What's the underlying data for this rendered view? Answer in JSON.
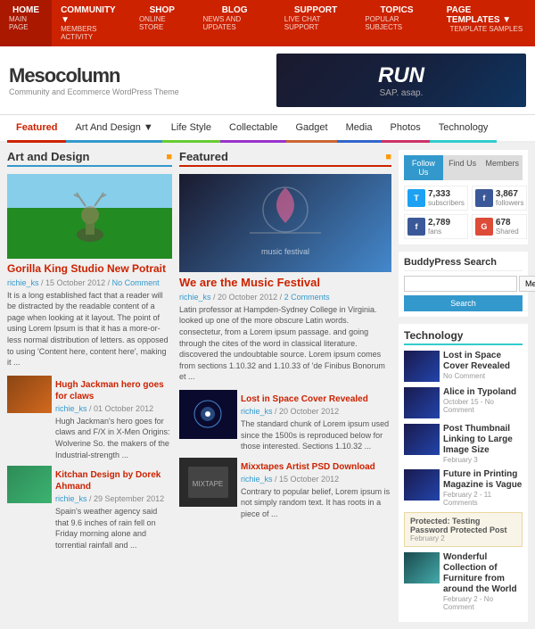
{
  "topnav": {
    "items": [
      {
        "label": "HOME",
        "sub": "main page",
        "hasArrow": false
      },
      {
        "label": "COMMUNITY",
        "sub": "members activity",
        "hasArrow": true
      },
      {
        "label": "SHOP",
        "sub": "online store",
        "hasArrow": false
      },
      {
        "label": "BLOG",
        "sub": "news and updates",
        "hasArrow": false
      },
      {
        "label": "SUPPORT",
        "sub": "live chat support",
        "hasArrow": false
      },
      {
        "label": "TOPICS",
        "sub": "popular subjects",
        "hasArrow": false
      },
      {
        "label": "PAGE TEMPLATES",
        "sub": "template samples",
        "hasArrow": true
      }
    ]
  },
  "header": {
    "site_title": "Mesocolumn",
    "site_desc": "Community and Ecommerce WordPress Theme",
    "banner_text": "RUN",
    "banner_sub": "SAP. asap."
  },
  "catnav": {
    "items": [
      {
        "label": "Featured",
        "cls": "active"
      },
      {
        "label": "Art And Design",
        "cls": "art",
        "hasArrow": true
      },
      {
        "label": "Life Style",
        "cls": "lifestyle"
      },
      {
        "label": "Collectable",
        "cls": "collectable"
      },
      {
        "label": "Gadget",
        "cls": "gadget"
      },
      {
        "label": "Media",
        "cls": "media"
      },
      {
        "label": "Photos",
        "cls": "photos"
      },
      {
        "label": "Technology",
        "cls": "tech"
      }
    ]
  },
  "left_col": {
    "section_title": "Art and Design",
    "articles": [
      {
        "title": "Gorilla King Studio New Potrait",
        "author": "richie_ks",
        "date": "15 October 2012",
        "comment": "No Comment",
        "excerpt": "It is a long established fact that a reader will be distracted by the readable content of a page when looking at it layout. The point of using Lorem Ipsum is that it has a more-or-less normal distribution of letters. as opposed to using 'Content here, content here', making it ...",
        "img_cls": "img-deer"
      }
    ],
    "small_articles": [
      {
        "title": "Hugh Jackman hero goes for claws",
        "author": "richie_ks",
        "date": "01 October 2012",
        "excerpt": "Hugh Jackman's hero goes for claws and F/X in X-Men Origins: Wolverine So. the makers of the Industrial-strength ...",
        "img_cls": "img-jackman"
      },
      {
        "title": "Kitchan Design by Dorek Ahmand",
        "author": "richie_ks",
        "date": "29 September 2012",
        "excerpt": "Spain's weather agency said that 9.6 inches of rain fell on Friday morning alone and torrential rainfall and ...",
        "img_cls": "img-kitchen"
      }
    ]
  },
  "mid_col": {
    "section_title": "Featured",
    "main_article": {
      "title": "We are the Music Festival",
      "author": "richie_ks",
      "date": "20 October 2012",
      "comment": "2 Comments",
      "excerpt": "Latin professor at Hampden-Sydney College in Virginia. looked up one of the more obscure Latin words. consectetur, from a Lorem ipsum passage. and going through the cites of the word in classical literature. discovered the undoubtable source. Lorem ipsum comes from sections 1.10.32 and 1.10.33 of 'de Finibus Bonorum et ...",
      "img_cls": "img-music"
    },
    "small_articles": [
      {
        "title": "Lost in Space Cover Revealed",
        "author": "richie_ks",
        "date": "20 October 2012",
        "excerpt": "The standard chunk of Lorem ipsum used since the 1500s is reproduced below for those interested. Sections 1.10.32 ...",
        "img_cls": "img-space"
      },
      {
        "title": "Mixxtapes Artist PSD Download",
        "author": "richie_ks",
        "date": "15 October 2012",
        "excerpt": "Contrary to popular belief, Lorem ipsum is not simply random text. It has roots in a piece of ...",
        "img_cls": "img-mixtape"
      }
    ]
  },
  "right_col": {
    "follow_us_label": "Follow Us",
    "find_us_label": "Find Us",
    "members_label": "Members",
    "social": [
      {
        "icon": "twitter",
        "icon_label": "T",
        "count": "7,333",
        "unit": "subscribers"
      },
      {
        "icon": "fb",
        "icon_label": "f",
        "count": "3,867",
        "unit": "followers"
      },
      {
        "icon": "fbfans",
        "icon_label": "f",
        "count": "2,789",
        "unit": "fans"
      },
      {
        "icon": "shared",
        "icon_label": "G",
        "count": "678",
        "unit": "Shared"
      }
    ],
    "search_title": "BuddyPress Search",
    "search_placeholder": "",
    "search_select": "Members",
    "search_btn": "Search",
    "tech_title": "Technology",
    "tech_articles": [
      {
        "title": "Lost in Space Cover Revealed",
        "meta": "No Comment",
        "img_cls": "img-tech1"
      },
      {
        "title": "Alice in Typoland",
        "meta": "October 15 - No Comment",
        "img_cls": "img-tech2"
      },
      {
        "title": "Post Thumbnail Linking to Large Image Size",
        "meta": "February 3",
        "img_cls": "img-tech3"
      },
      {
        "title": "Future in Printing Magazine is Vague",
        "meta": "February 2 - 11 Comments",
        "img_cls": "img-tech4"
      }
    ],
    "protected_post": "Protected: Testing Password Protected Post",
    "protected_date": "February 2",
    "last_article": {
      "title": "Wonderful Collection of Furniture from around the World",
      "meta": "February 2 - No Comment",
      "img_cls": "img-tech5"
    }
  }
}
